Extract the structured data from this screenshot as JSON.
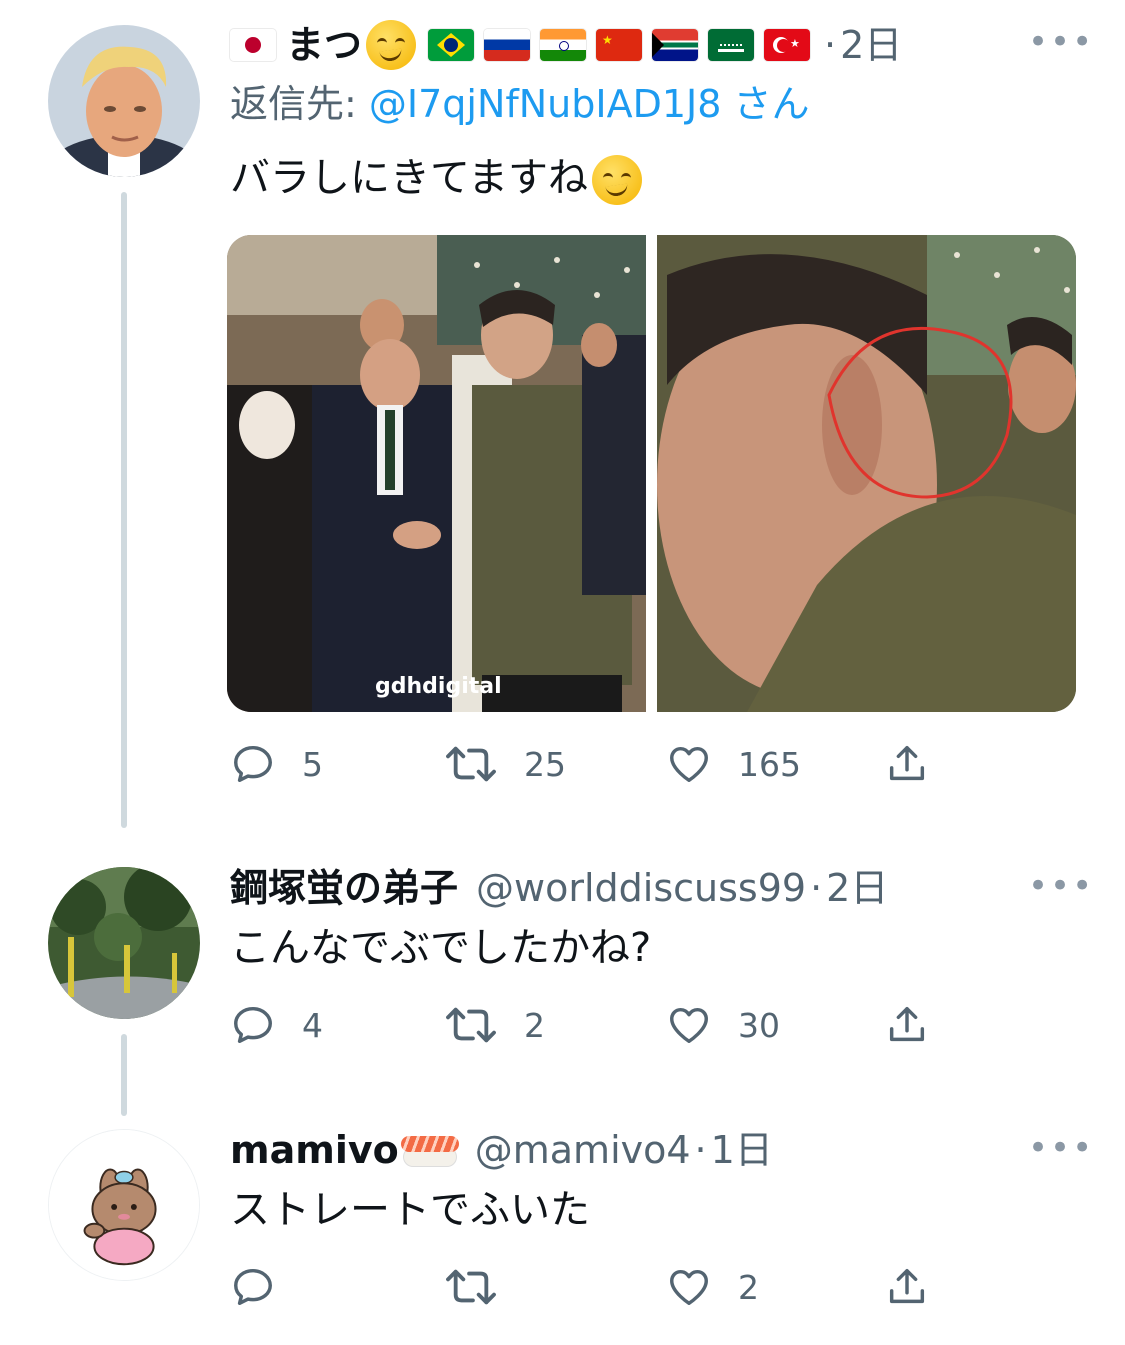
{
  "tweets": [
    {
      "name": "まつ",
      "time": "2日",
      "reply_prefix": "返信先: ",
      "reply_mention": "@I7qjNfNubIAD1J8",
      "reply_suffix": " さん",
      "text": "バラしにきてますね",
      "image_watermark": "gdhdigital",
      "counts": {
        "reply": "5",
        "retweet": "25",
        "like": "165"
      },
      "flags": [
        "japan",
        "brazil",
        "russia",
        "india",
        "china",
        "south-africa",
        "saudi-arabia",
        "turkey"
      ]
    },
    {
      "name": "鋼塚蛍の弟子",
      "handle": "@worlddiscuss99",
      "time": "2日",
      "text": "こんなでぶでしたかね?",
      "counts": {
        "reply": "4",
        "retweet": "2",
        "like": "30"
      }
    },
    {
      "name": "mamivo",
      "handle": "@mamivo4",
      "time": "1日",
      "text": "ストレートでふいた",
      "counts": {
        "reply": "",
        "retweet": "",
        "like": "2"
      }
    }
  ],
  "separator": "·",
  "more_label": "•••",
  "colors": {
    "link": "#1d9bf0",
    "muted": "#536471",
    "thread_line": "#cfd9de"
  }
}
